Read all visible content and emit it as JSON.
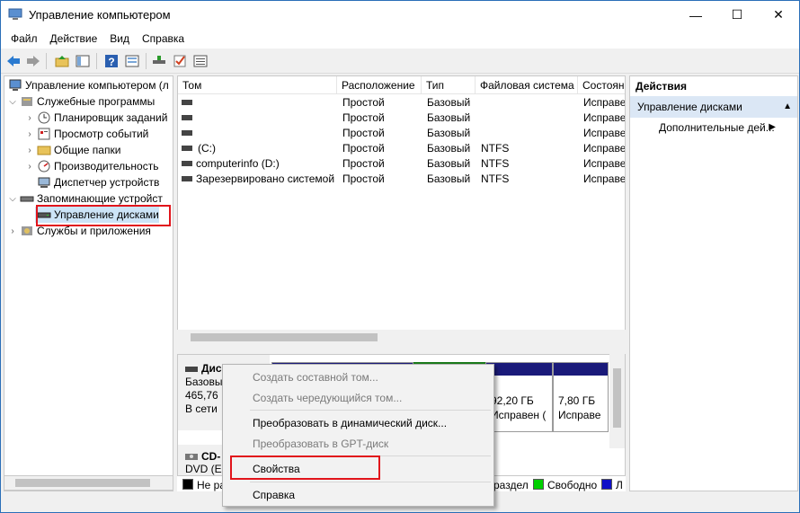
{
  "window": {
    "title": "Управление компьютером",
    "minimize": "—",
    "maximize": "☐",
    "close": "✕"
  },
  "menu": [
    "Файл",
    "Действие",
    "Вид",
    "Справка"
  ],
  "toolbar": {
    "icons": [
      "back-icon",
      "forward-icon",
      "up-folder-icon",
      "show-tree-icon",
      "help-icon",
      "properties-icon",
      "disk-connect-icon",
      "check-icon",
      "list-icon"
    ]
  },
  "tree": {
    "root": "Управление компьютером (л",
    "system_tools": "Служебные программы",
    "task_scheduler": "Планировщик заданий",
    "event_viewer": "Просмотр событий",
    "shared_folders": "Общие папки",
    "performance": "Производительность",
    "device_manager": "Диспетчер устройств",
    "storage": "Запоминающие устройст",
    "disk_management": "Управление дисками",
    "services_apps": "Службы и приложения"
  },
  "volumes": {
    "columns": [
      "Том",
      "Расположение",
      "Тип",
      "Файловая система",
      "Состояние"
    ],
    "rows": [
      {
        "name": "",
        "layout": "Простой",
        "type": "Базовый",
        "fs": "",
        "status": "Исправе"
      },
      {
        "name": "",
        "layout": "Простой",
        "type": "Базовый",
        "fs": "",
        "status": "Исправе"
      },
      {
        "name": "",
        "layout": "Простой",
        "type": "Базовый",
        "fs": "",
        "status": "Исправе"
      },
      {
        "name": "(C:)",
        "layout": "Простой",
        "type": "Базовый",
        "fs": "NTFS",
        "status": "Исправе"
      },
      {
        "name": "computerinfo (D:)",
        "layout": "Простой",
        "type": "Базовый",
        "fs": "NTFS",
        "status": "Исправе"
      },
      {
        "name": "Зарезервировано системой",
        "layout": "Простой",
        "type": "Базовый",
        "fs": "NTFS",
        "status": "Исправе"
      }
    ]
  },
  "disk": {
    "label": "Дис",
    "type": "Базовы",
    "size": "465,76 I",
    "status": "В сети",
    "part_a_size": "92,20 ГБ",
    "part_a_status": "Исправен (",
    "part_b_size": "7,80 ГБ",
    "part_b_status": "Исправе"
  },
  "cdrom": {
    "label": "CD-",
    "line2": "DVD (E"
  },
  "legend": {
    "not_allocated": "Не ра",
    "partition": "раздел",
    "free": "Свободно",
    "logical": "Л",
    "colors": {
      "not_allocated": "#000000",
      "free": "#00d000",
      "logical": "#1010c8"
    }
  },
  "actions": {
    "header": "Действия",
    "section": "Управление дисками",
    "more": "Дополнительные дей..."
  },
  "context_menu": {
    "create_spanned": "Создать составной том...",
    "create_striped": "Создать чередующийся том...",
    "convert_dynamic": "Преобразовать в динамический диск...",
    "convert_gpt": "Преобразовать в GPT-диск",
    "properties": "Свойства",
    "help": "Справка"
  },
  "colors": {
    "highlight": "#e1141b",
    "disk_bar": "#1a1a7a",
    "selection": "#dbe7f5"
  }
}
